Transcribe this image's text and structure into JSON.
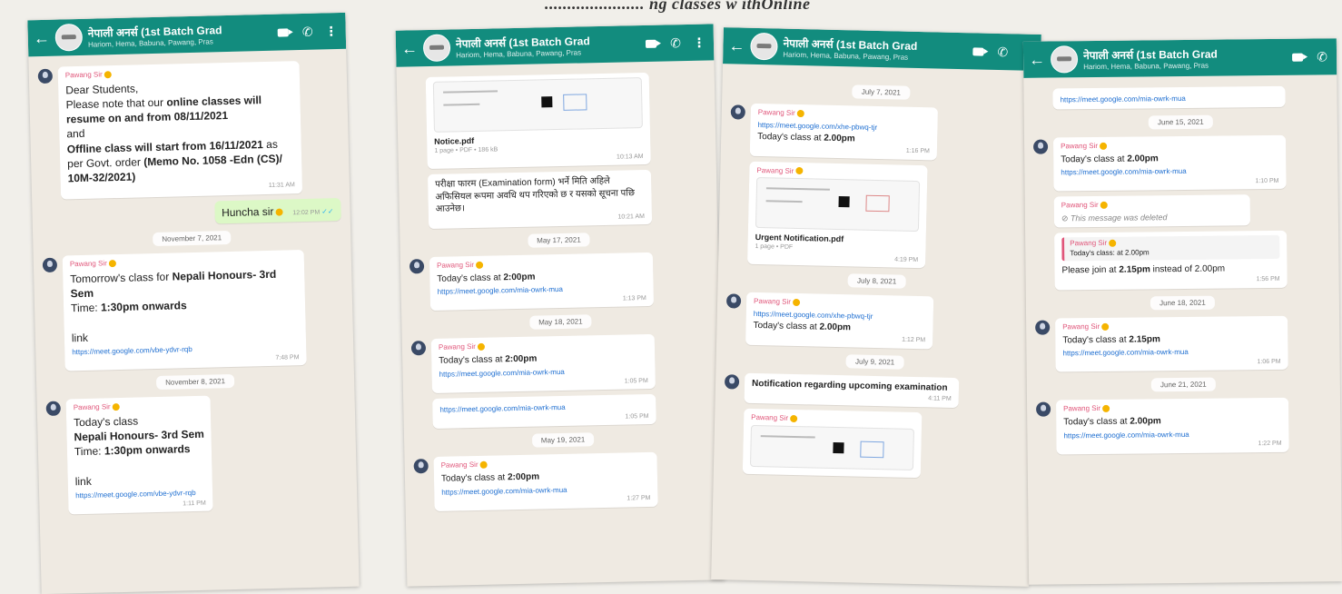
{
  "caption": "...................... ng classes w ithOnline ",
  "header": {
    "group_title": "नेपाली अनर्स (1st Batch Grad",
    "participants": "Hariom, Hema, Babuna, Pawang, Pras"
  },
  "common": {
    "sender": "Pawang Sir",
    "todays_class": "Today's class",
    "meet_link": "https://meet.google.com/mia-owrk-mua"
  },
  "phone1": {
    "m1": {
      "line1": "Dear Students,",
      "line2": "Please note that our",
      "line2b": "online classes will resume on and from 08/11/2021",
      "line3": "and",
      "line4b": "Offline class will start from 16/11/2021",
      "line4": "as per Govt. order",
      "line5b": "(Memo No. 1058 -Edn (CS)/ 10M-32/2021)",
      "time": "11:31 AM"
    },
    "out": {
      "text": "Huncha sir",
      "time": "12:02 PM"
    },
    "date1": "November 7, 2021",
    "m2": {
      "line1": "Tomorrow's class for",
      "line1b": "Nepali Honours- 3rd Sem",
      "line2": "Time:",
      "line2b": "1:30pm onwards",
      "line3": "link",
      "link": "https://meet.google.com/vbe-ydvr-rqb",
      "time": "7:48 PM"
    },
    "date2": "November 8, 2021",
    "m3": {
      "line1": "Today's class",
      "line2b": "Nepali Honours- 3rd Sem",
      "line3": "Time:",
      "line3b": "1:30pm onwards",
      "line4": "link",
      "link": "https://meet.google.com/vbe-ydvr-rqb",
      "time": "1:11 PM"
    }
  },
  "phone2": {
    "doc": {
      "name": "Notice.pdf",
      "meta": "1 page • PDF • 186 kB",
      "time": "10:13 AM"
    },
    "m_hindi": {
      "text": "परीक्षा फारम (Examination form) भर्ने मिति अहिले अफिसियल रूपमा अवधि थप गरिएको छ र यसको सूचना पछि आउनेछ।",
      "time": "10:21 AM"
    },
    "date1": "May 17, 2021",
    "m1": {
      "time_bold": "2:00pm",
      "time": "1:13 PM"
    },
    "date2": "May 18, 2021",
    "m2": {
      "time_bold": "2:00pm",
      "time": "1:05 PM",
      "time2": "1:05 PM"
    },
    "date3": "May 19, 2021",
    "m3": {
      "time_bold": "2:00pm",
      "time": "1:27 PM"
    }
  },
  "phone3": {
    "date1": "July 7, 2021",
    "m1": {
      "link": "https://meet.google.com/xhe-pbwq-tjr",
      "time_bold": "2.00pm",
      "time": "1:16 PM"
    },
    "doc": {
      "name": "Urgent Notification.pdf",
      "meta": "1 page • PDF",
      "time": "4:19 PM"
    },
    "date2": "July 8, 2021",
    "m2": {
      "link": "https://meet.google.com/xhe-pbwq-tjr",
      "time_bold": "2.00pm",
      "time": "1:12 PM"
    },
    "date3": "July 9, 2021",
    "m3": {
      "text": "Notification regarding upcoming examination",
      "time": "4:11 PM"
    }
  },
  "phone4": {
    "top_link": "https://meet.google.com/mia-owrk-mua",
    "date1": "June 15, 2021",
    "m1": {
      "time_bold": "2.00pm",
      "time": "1:10 PM"
    },
    "deleted": "This message was deleted",
    "quote": {
      "text": "Today's class: at 2.00pm"
    },
    "reply": {
      "pre": "Please join at",
      "bold": "2.15pm",
      "post": "instead of 2.00pm",
      "time": "1:56 PM"
    },
    "date2": "June 18, 2021",
    "m2": {
      "time_bold": "2.15pm",
      "time": "1:06 PM"
    },
    "date3": "June 21, 2021",
    "m3": {
      "time_bold": "2.00pm",
      "time": "1:22 PM"
    }
  }
}
